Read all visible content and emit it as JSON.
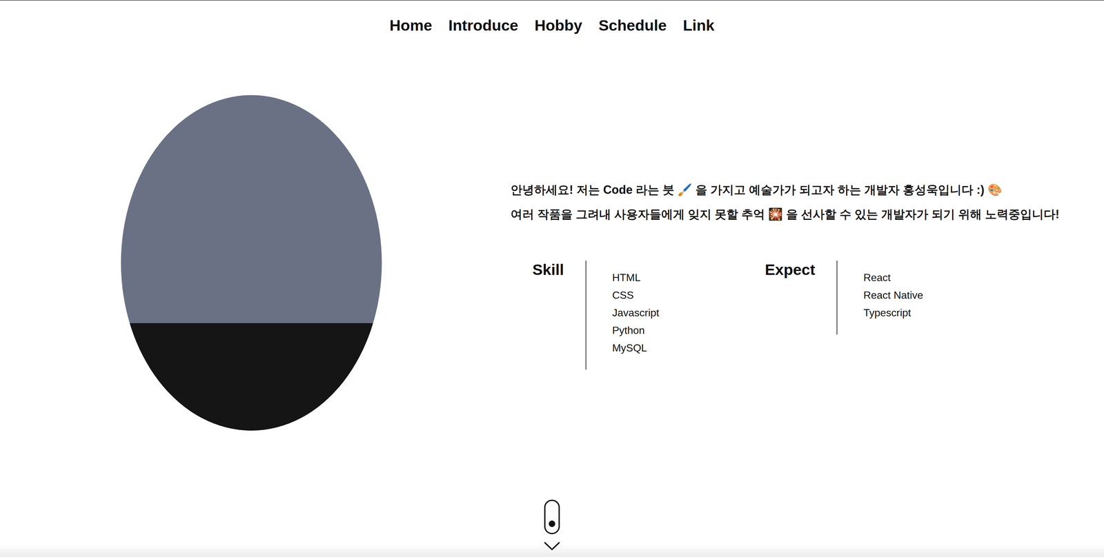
{
  "nav": {
    "items": [
      "Home",
      "Introduce",
      "Hobby",
      "Schedule",
      "Link"
    ]
  },
  "intro": {
    "lines": [
      "안녕하세요! 저는 Code 라는 붓 🖌️ 을 가지고 예술가가 되고자 하는 개발자 홍성욱입니다 :) 🎨",
      "여러 작품을 그려내 사용자들에게 잊지 못할 추억 🎇 을 선사할 수 있는 개발자가 되기 위해 노력중입니다!"
    ]
  },
  "groups": [
    {
      "title": "Skill",
      "items": [
        "HTML",
        "CSS",
        "Javascript",
        "Python",
        "MySQL"
      ]
    },
    {
      "title": "Expect",
      "items": [
        "React",
        "React Native",
        "Typescript"
      ]
    }
  ]
}
